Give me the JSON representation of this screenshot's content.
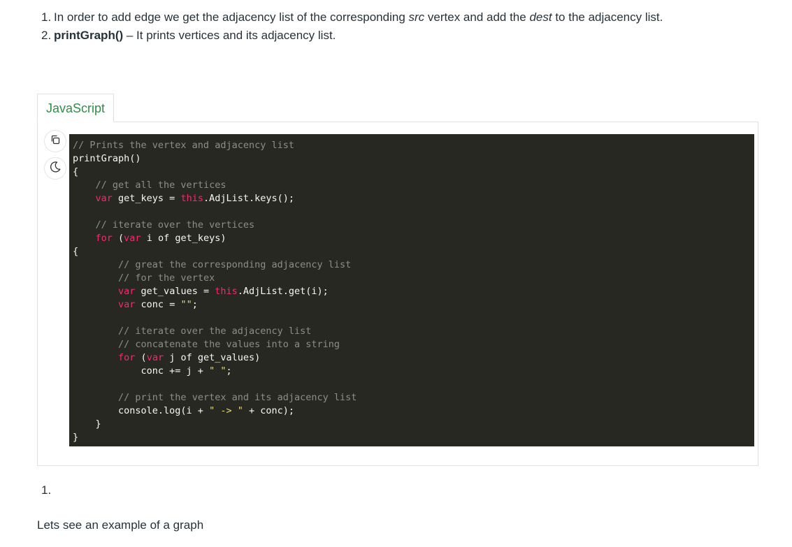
{
  "steps": [
    {
      "num": "1.",
      "p1": "In order to add edge we get the adjacency list of the corresponding ",
      "em1": "src",
      "p2": " vertex and add the ",
      "em2": "dest",
      "p3": " to the adjacency list."
    },
    {
      "num": "2.",
      "bold": "printGraph()",
      "rest": " – It prints vertices and its adjacency list."
    }
  ],
  "code_tab": {
    "label": "JavaScript"
  },
  "code_tools": {
    "copy_icon": "copy-icon",
    "theme_icon": "moon-icon"
  },
  "code_lines": [
    [
      {
        "t": "c",
        "v": "// Prints the vertex and adjacency list"
      }
    ],
    [
      {
        "t": "p",
        "v": "printGraph()"
      }
    ],
    [
      {
        "t": "p",
        "v": "{"
      }
    ],
    [
      {
        "t": "p",
        "v": "    "
      },
      {
        "t": "c",
        "v": "// get all the vertices"
      }
    ],
    [
      {
        "t": "p",
        "v": "    "
      },
      {
        "t": "k",
        "v": "var"
      },
      {
        "t": "p",
        "v": " get_keys = "
      },
      {
        "t": "k",
        "v": "this"
      },
      {
        "t": "p",
        "v": ".AdjList.keys();"
      }
    ],
    [
      {
        "t": "p",
        "v": ""
      }
    ],
    [
      {
        "t": "p",
        "v": "    "
      },
      {
        "t": "c",
        "v": "// iterate over the vertices"
      }
    ],
    [
      {
        "t": "p",
        "v": "    "
      },
      {
        "t": "k",
        "v": "for"
      },
      {
        "t": "p",
        "v": " ("
      },
      {
        "t": "k",
        "v": "var"
      },
      {
        "t": "p",
        "v": " i of get_keys)"
      }
    ],
    [
      {
        "t": "p",
        "v": "{"
      }
    ],
    [
      {
        "t": "p",
        "v": "        "
      },
      {
        "t": "c",
        "v": "// great the corresponding adjacency list"
      }
    ],
    [
      {
        "t": "p",
        "v": "        "
      },
      {
        "t": "c",
        "v": "// for the vertex"
      }
    ],
    [
      {
        "t": "p",
        "v": "        "
      },
      {
        "t": "k",
        "v": "var"
      },
      {
        "t": "p",
        "v": " get_values = "
      },
      {
        "t": "k",
        "v": "this"
      },
      {
        "t": "p",
        "v": ".AdjList.get(i);"
      }
    ],
    [
      {
        "t": "p",
        "v": "        "
      },
      {
        "t": "k",
        "v": "var"
      },
      {
        "t": "p",
        "v": " conc = "
      },
      {
        "t": "s",
        "v": "\"\""
      },
      {
        "t": "p",
        "v": ";"
      }
    ],
    [
      {
        "t": "p",
        "v": ""
      }
    ],
    [
      {
        "t": "p",
        "v": "        "
      },
      {
        "t": "c",
        "v": "// iterate over the adjacency list"
      }
    ],
    [
      {
        "t": "p",
        "v": "        "
      },
      {
        "t": "c",
        "v": "// concatenate the values into a string"
      }
    ],
    [
      {
        "t": "p",
        "v": "        "
      },
      {
        "t": "k",
        "v": "for"
      },
      {
        "t": "p",
        "v": " ("
      },
      {
        "t": "k",
        "v": "var"
      },
      {
        "t": "p",
        "v": " j of get_values)"
      }
    ],
    [
      {
        "t": "p",
        "v": "            conc += j + "
      },
      {
        "t": "s",
        "v": "\" \""
      },
      {
        "t": "p",
        "v": ";"
      }
    ],
    [
      {
        "t": "p",
        "v": ""
      }
    ],
    [
      {
        "t": "p",
        "v": "        "
      },
      {
        "t": "c",
        "v": "// print the vertex and its adjacency list"
      }
    ],
    [
      {
        "t": "p",
        "v": "        console.log(i + "
      },
      {
        "t": "s",
        "v": "\" -> \""
      },
      {
        "t": "p",
        "v": " + conc);"
      }
    ],
    [
      {
        "t": "p",
        "v": "    }"
      }
    ],
    [
      {
        "t": "p",
        "v": "}"
      }
    ]
  ],
  "trailing": {
    "list_num": "1.",
    "text": "Lets see an example of a graph"
  },
  "colors": {
    "accent_green": "#2f8d46",
    "code_bg": "#272822",
    "code_keyword": "#f92672",
    "code_comment": "#8e8e85",
    "code_string": "#e6db74",
    "code_plain": "#f8f8f2"
  }
}
